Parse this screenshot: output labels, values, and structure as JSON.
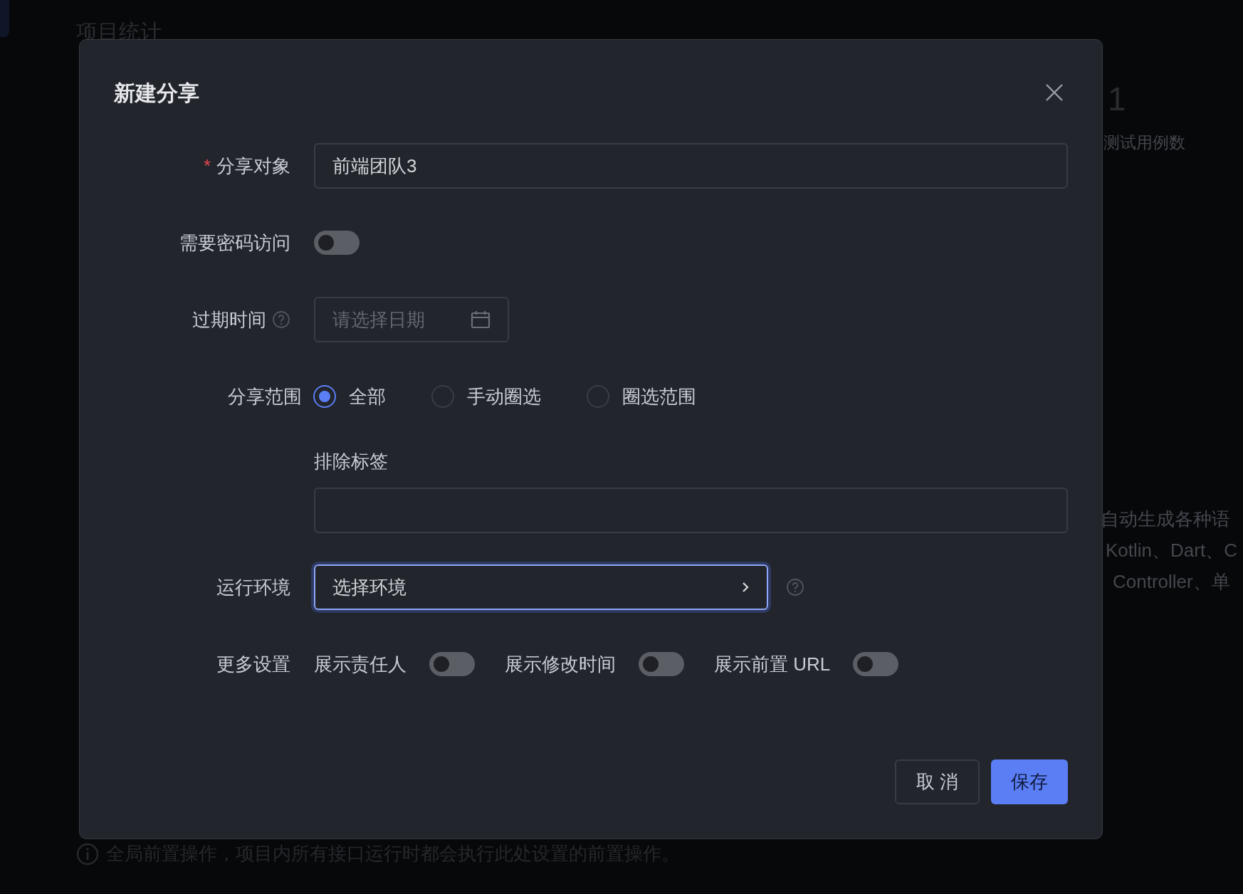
{
  "background": {
    "page_title": "项目统计",
    "stat_value": "1",
    "stat_label": "测试用例数",
    "description_lines": [
      "自动生成各种语",
      "Kotlin、Dart、C",
      "Controller、单"
    ],
    "footer_note": "全局前置操作，项目内所有接口运行时都会执行此处设置的前置操作。"
  },
  "dialog": {
    "title": "新建分享",
    "fields": [
      {
        "kind": "text",
        "label": "分享对象",
        "required_mark": "*",
        "value": "前端团队3"
      },
      {
        "kind": "switch",
        "label": "需要密码访问",
        "on": false
      },
      {
        "kind": "date",
        "label": "过期时间",
        "help": true,
        "placeholder": "请选择日期"
      },
      {
        "kind": "radio",
        "label": "分享范围",
        "options": [
          {
            "label": "全部",
            "selected": true
          },
          {
            "label": "手动圈选",
            "selected": false
          },
          {
            "label": "圈选范围",
            "selected": false
          }
        ]
      },
      {
        "kind": "tags",
        "label": "排除标签"
      },
      {
        "kind": "select",
        "label": "运行环境",
        "value": "选择环境",
        "focused": true,
        "help": true
      },
      {
        "kind": "switches",
        "label": "更多设置",
        "options": [
          {
            "label": "展示责任人",
            "on": false
          },
          {
            "label": "展示修改时间",
            "on": false
          },
          {
            "label": "展示前置 URL",
            "on": false
          }
        ]
      }
    ],
    "buttons": [
      {
        "label": "取 消",
        "primary": false
      },
      {
        "label": "保存",
        "primary": true
      }
    ]
  }
}
